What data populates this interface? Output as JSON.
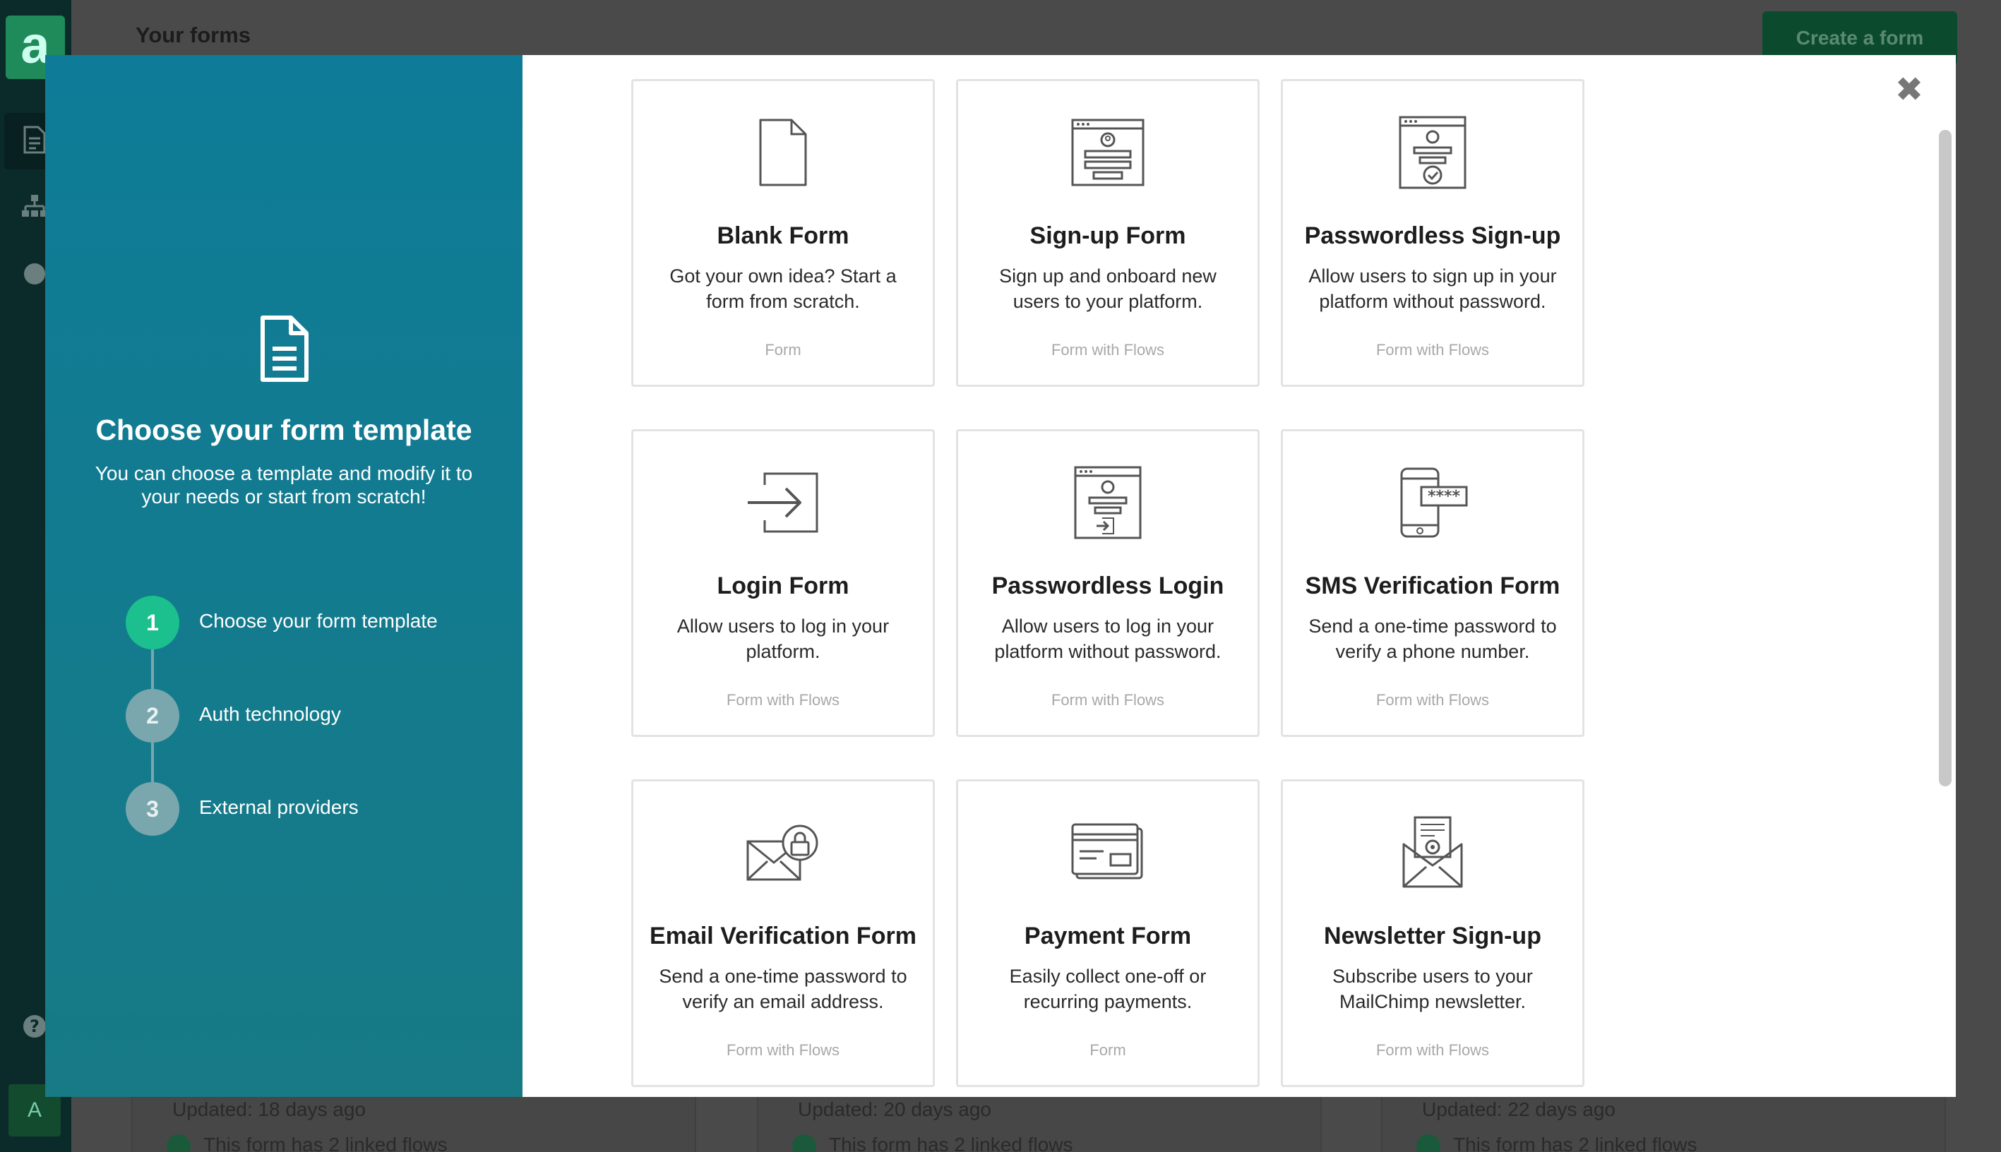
{
  "app": {
    "logo_letter": "a",
    "page_title": "Your forms",
    "create_button": "Create a form",
    "avatar_letter": "A",
    "help_icon": "question-icon",
    "background_cards": [
      {
        "updated": "Updated: 18 days ago",
        "flows": "This form has 2 linked flows"
      },
      {
        "updated": "Updated: 20 days ago",
        "flows": "This form has 2 linked flows"
      },
      {
        "updated": "Updated: 22 days ago",
        "flows": "This form has 2 linked flows"
      }
    ]
  },
  "modal": {
    "left": {
      "title": "Choose your form template",
      "subtitle": "You can choose a template and modify it to your needs or start from scratch!",
      "steps": [
        {
          "number": "1",
          "label": "Choose your form template",
          "state": "active"
        },
        {
          "number": "2",
          "label": "Auth technology",
          "state": "inactive"
        },
        {
          "number": "3",
          "label": "External providers",
          "state": "inactive"
        }
      ]
    },
    "close_label": "✖",
    "templates": [
      {
        "icon": "blank-document-icon",
        "title": "Blank Form",
        "description": "Got your own idea? Start a form from scratch.",
        "tag": "Form"
      },
      {
        "icon": "signup-window-icon",
        "title": "Sign-up Form",
        "description": "Sign up and onboard new users to your platform.",
        "tag": "Form with Flows"
      },
      {
        "icon": "passwordless-signup-icon",
        "title": "Passwordless Sign-up",
        "description": "Allow users to sign up in your platform without password.",
        "tag": "Form with Flows"
      },
      {
        "icon": "login-arrow-icon",
        "title": "Login Form",
        "description": "Allow users to log in your platform.",
        "tag": "Form with Flows"
      },
      {
        "icon": "passwordless-login-icon",
        "title": "Passwordless Login",
        "description": "Allow users to log in your platform without password.",
        "tag": "Form with Flows"
      },
      {
        "icon": "sms-phone-icon",
        "title": "SMS Verification Form",
        "description": "Send a one-time password to verify a phone number.",
        "tag": "Form with Flows"
      },
      {
        "icon": "email-lock-icon",
        "title": "Email Verification Form",
        "description": "Send a one-time password to verify an email address.",
        "tag": "Form with Flows"
      },
      {
        "icon": "credit-card-icon",
        "title": "Payment Form",
        "description": "Easily collect one-off or recurring payments.",
        "tag": "Form"
      },
      {
        "icon": "newsletter-envelope-icon",
        "title": "Newsletter Sign-up",
        "description": "Subscribe users to your MailChimp newsletter.",
        "tag": "Form with Flows"
      }
    ]
  }
}
